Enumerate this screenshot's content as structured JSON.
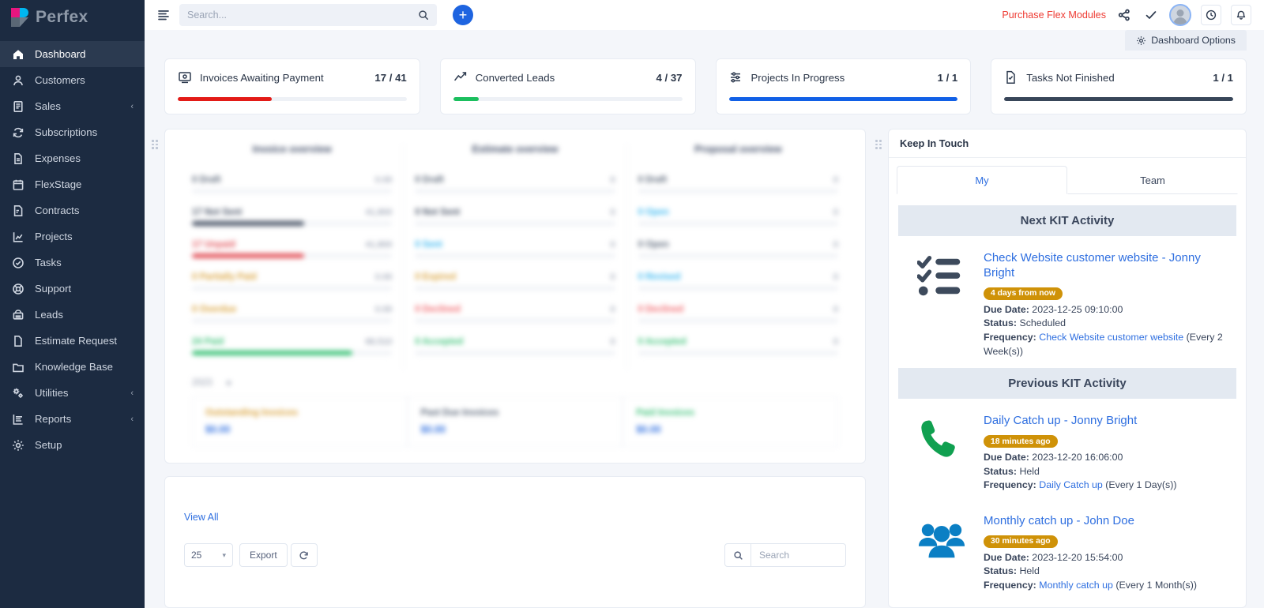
{
  "brand": {
    "name": "Perfex"
  },
  "sidebar": {
    "items": [
      {
        "label": "Dashboard",
        "icon": "home-icon",
        "active": true,
        "caret": ""
      },
      {
        "label": "Customers",
        "icon": "user-icon",
        "active": false,
        "caret": ""
      },
      {
        "label": "Sales",
        "icon": "receipt-icon",
        "active": false,
        "caret": "‹"
      },
      {
        "label": "Subscriptions",
        "icon": "refresh-icon",
        "active": false,
        "caret": ""
      },
      {
        "label": "Expenses",
        "icon": "document-icon",
        "active": false,
        "caret": ""
      },
      {
        "label": "FlexStage",
        "icon": "calendar-icon",
        "active": false,
        "caret": ""
      },
      {
        "label": "Contracts",
        "icon": "contract-icon",
        "active": false,
        "caret": ""
      },
      {
        "label": "Projects",
        "icon": "chart-icon",
        "active": false,
        "caret": ""
      },
      {
        "label": "Tasks",
        "icon": "check-circle-icon",
        "active": false,
        "caret": ""
      },
      {
        "label": "Support",
        "icon": "lifebuoy-icon",
        "active": false,
        "caret": ""
      },
      {
        "label": "Leads",
        "icon": "phone-icon",
        "active": false,
        "caret": ""
      },
      {
        "label": "Estimate Request",
        "icon": "file-icon",
        "active": false,
        "caret": ""
      },
      {
        "label": "Knowledge Base",
        "icon": "folder-icon",
        "active": false,
        "caret": ""
      },
      {
        "label": "Utilities",
        "icon": "gears-icon",
        "active": false,
        "caret": "‹"
      },
      {
        "label": "Reports",
        "icon": "report-icon",
        "active": false,
        "caret": "‹"
      },
      {
        "label": "Setup",
        "icon": "gear-icon",
        "active": false,
        "caret": ""
      }
    ]
  },
  "topbar": {
    "search_placeholder": "Search...",
    "add_label": "+",
    "purchase_label": "Purchase Flex Modules"
  },
  "dashboard_options": {
    "label": "Dashboard Options"
  },
  "stats": [
    {
      "title": "Invoices Awaiting Payment",
      "value": "17 / 41",
      "percent": 41,
      "color": "#e31b17",
      "icon": "invoice-icon"
    },
    {
      "title": "Converted Leads",
      "value": "4 / 37",
      "percent": 11,
      "color": "#1bbf5e",
      "icon": "trending-up-icon"
    },
    {
      "title": "Projects In Progress",
      "value": "1 / 1",
      "percent": 100,
      "color": "#1160e6",
      "icon": "sliders-icon"
    },
    {
      "title": "Tasks Not Finished",
      "value": "1 / 1",
      "percent": 100,
      "color": "#384659",
      "icon": "task-file-icon"
    }
  ],
  "overview": {
    "columns": [
      {
        "head": "Invoice overview",
        "rows": [
          {
            "name": "0 Draft",
            "amount": "0.00",
            "percent": 0,
            "color": "#5b6779",
            "name_color": "#5b6779"
          },
          {
            "name": "17 Not Sent",
            "amount": "41,800",
            "percent": 56,
            "color": "#4a5568",
            "name_color": "#4a5568"
          },
          {
            "name": "17 Unpaid",
            "amount": "41,800",
            "percent": 56,
            "color": "#e2525a",
            "name_color": "#e2525a"
          },
          {
            "name": "0 Partially Paid",
            "amount": "0.00",
            "percent": 0,
            "color": "#d9a23b",
            "name_color": "#d9a23b"
          },
          {
            "name": "0 Overdue",
            "amount": "0.00",
            "percent": 0,
            "color": "#d9a23b",
            "name_color": "#d9a23b"
          },
          {
            "name": "24 Paid",
            "amount": "66,510",
            "percent": 80,
            "color": "#3cc278",
            "name_color": "#3cc278"
          }
        ]
      },
      {
        "head": "Estimate overview",
        "rows": [
          {
            "name": "0 Draft",
            "amount": "0",
            "percent": 0,
            "color": "#5b6779",
            "name_color": "#5b6779"
          },
          {
            "name": "0 Not Sent",
            "amount": "0",
            "percent": 0,
            "color": "#4a5568",
            "name_color": "#4a5568"
          },
          {
            "name": "0 Sent",
            "amount": "0",
            "percent": 0,
            "color": "#38b6ef",
            "name_color": "#38b6ef"
          },
          {
            "name": "0 Expired",
            "amount": "0",
            "percent": 0,
            "color": "#d9a23b",
            "name_color": "#d9a23b"
          },
          {
            "name": "0 Declined",
            "amount": "0",
            "percent": 0,
            "color": "#f0666c",
            "name_color": "#f0666c"
          },
          {
            "name": "0 Accepted",
            "amount": "0",
            "percent": 0,
            "color": "#3cc278",
            "name_color": "#3cc278"
          }
        ]
      },
      {
        "head": "Proposal overview",
        "rows": [
          {
            "name": "0 Draft",
            "amount": "0",
            "percent": 0,
            "color": "#5b6779",
            "name_color": "#5b6779"
          },
          {
            "name": "0 Open",
            "amount": "0",
            "percent": 0,
            "color": "#38b6ef",
            "name_color": "#38b6ef"
          },
          {
            "name": "0 Open",
            "amount": "0",
            "percent": 0,
            "color": "#5b6779",
            "name_color": "#5b6779"
          },
          {
            "name": "0 Revised",
            "amount": "0",
            "percent": 0,
            "color": "#38b6ef",
            "name_color": "#38b6ef"
          },
          {
            "name": "0 Declined",
            "amount": "0",
            "percent": 0,
            "color": "#f0666c",
            "name_color": "#f0666c"
          },
          {
            "name": "0 Accepted",
            "amount": "0",
            "percent": 0,
            "color": "#3cc278",
            "name_color": "#3cc278"
          }
        ]
      }
    ],
    "year": "2023",
    "cards": [
      {
        "title": "Outstanding Invoices",
        "value": "$0.00",
        "color": "#d9a23b"
      },
      {
        "title": "Past Due Invoices",
        "value": "$0.00",
        "color": "#5b6779"
      },
      {
        "title": "Paid Invoices",
        "value": "$0.00",
        "color": "#3cc278"
      }
    ]
  },
  "table_controls": {
    "view_all": "View All",
    "page_size": "25",
    "export_label": "Export",
    "refresh_icon": "refresh-icon",
    "search_icon": "search-icon",
    "search_placeholder": "Search"
  },
  "keep_in_touch": {
    "title": "Keep In Touch",
    "tabs": [
      {
        "label": "My",
        "active": true
      },
      {
        "label": "Team",
        "active": false
      }
    ],
    "sections": [
      {
        "heading": "Next KIT Activity",
        "items": [
          {
            "icon": "checklist-icon",
            "icon_color": "#3d4a5c",
            "title": "Check Website customer website - Jonny Bright",
            "badge": "4 days from now",
            "due_label": "Due Date:",
            "due_value": "2023-12-25 09:10:00",
            "status_label": "Status:",
            "status_value": "Scheduled",
            "frequency_label": "Frequency:",
            "frequency_link": "Check Website customer website",
            "frequency_suffix": "(Every 2 Week(s))"
          }
        ]
      },
      {
        "heading": "Previous KIT Activity",
        "items": [
          {
            "icon": "phone-call-icon",
            "icon_color": "#10a050",
            "title": "Daily Catch up - Jonny Bright",
            "badge": "18 minutes ago",
            "due_label": "Due Date:",
            "due_value": "2023-12-20 16:06:00",
            "status_label": "Status:",
            "status_value": "Held",
            "frequency_label": "Frequency:",
            "frequency_link": "Daily Catch up",
            "frequency_suffix": "(Every 1 Day(s))"
          },
          {
            "icon": "people-icon",
            "icon_color": "#0b7fc4",
            "title": "Monthly catch up - John Doe",
            "badge": "30 minutes ago",
            "due_label": "Due Date:",
            "due_value": "2023-12-20 15:54:00",
            "status_label": "Status:",
            "status_value": "Held",
            "frequency_label": "Frequency:",
            "frequency_link": "Monthly catch up",
            "frequency_suffix": "(Every 1 Month(s))"
          }
        ]
      }
    ]
  }
}
